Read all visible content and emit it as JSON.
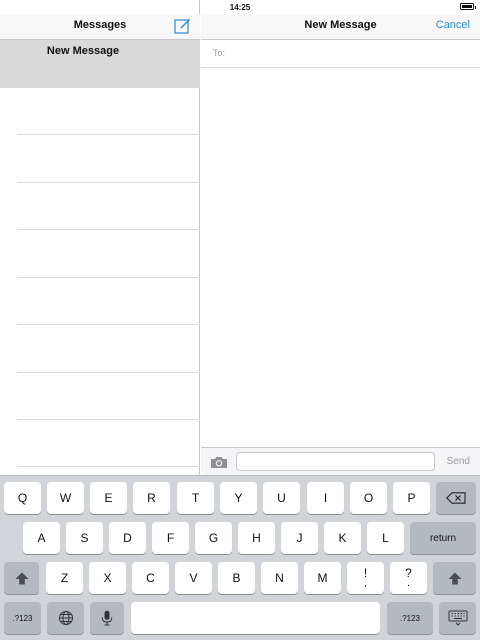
{
  "status_bar": {
    "time": "14:25"
  },
  "sidebar": {
    "title": "Messages",
    "selected_conversation": "New Message",
    "compose_icon": "compose-icon"
  },
  "main": {
    "title": "New Message",
    "cancel_label": "Cancel",
    "to_label": "To:",
    "to_value": "",
    "message_value": "",
    "send_label": "Send",
    "camera_icon": "camera-icon"
  },
  "keyboard": {
    "row1": [
      "Q",
      "W",
      "E",
      "R",
      "T",
      "Y",
      "U",
      "I",
      "O",
      "P"
    ],
    "row2": [
      "A",
      "S",
      "D",
      "F",
      "G",
      "H",
      "J",
      "K",
      "L"
    ],
    "row3": [
      "Z",
      "X",
      "C",
      "V",
      "B",
      "N",
      "M",
      "!",
      ".",
      "?"
    ],
    "return_label": "return",
    "numbers_label": ".?123",
    "icons": [
      "backspace-icon",
      "shift-icon",
      "globe-icon",
      "microphone-icon",
      "keyboard-hide-icon"
    ]
  },
  "colors": {
    "accent": "#2a8cd8",
    "keyboard_bg": "#d1d4d9",
    "selected_row": "#d9d9d9"
  }
}
